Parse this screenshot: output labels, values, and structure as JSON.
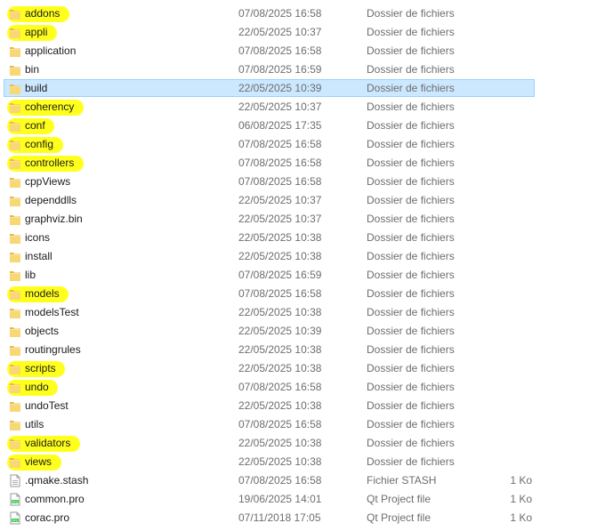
{
  "rows": [
    {
      "name": "addons",
      "date": "07/08/2025 16:58",
      "type": "Dossier de fichiers",
      "size": "",
      "icon": "folder-icon",
      "highlight": true
    },
    {
      "name": "appli",
      "date": "22/05/2025 10:37",
      "type": "Dossier de fichiers",
      "size": "",
      "icon": "folder-icon",
      "highlight": true
    },
    {
      "name": "application",
      "date": "07/08/2025 16:58",
      "type": "Dossier de fichiers",
      "size": "",
      "icon": "folder-icon",
      "highlight": false
    },
    {
      "name": "bin",
      "date": "07/08/2025 16:59",
      "type": "Dossier de fichiers",
      "size": "",
      "icon": "folder-icon",
      "highlight": false
    },
    {
      "name": "build",
      "date": "22/05/2025 10:39",
      "type": "Dossier de fichiers",
      "size": "",
      "icon": "folder-icon",
      "highlight": false,
      "selected": true
    },
    {
      "name": "coherency",
      "date": "22/05/2025 10:37",
      "type": "Dossier de fichiers",
      "size": "",
      "icon": "folder-icon",
      "highlight": true
    },
    {
      "name": "conf",
      "date": "06/08/2025 17:35",
      "type": "Dossier de fichiers",
      "size": "",
      "icon": "folder-icon",
      "highlight": true
    },
    {
      "name": "config",
      "date": "07/08/2025 16:58",
      "type": "Dossier de fichiers",
      "size": "",
      "icon": "folder-icon",
      "highlight": true
    },
    {
      "name": "controllers",
      "date": "07/08/2025 16:58",
      "type": "Dossier de fichiers",
      "size": "",
      "icon": "folder-icon",
      "highlight": true
    },
    {
      "name": "cppViews",
      "date": "07/08/2025 16:58",
      "type": "Dossier de fichiers",
      "size": "",
      "icon": "folder-icon",
      "highlight": false
    },
    {
      "name": "dependdlls",
      "date": "22/05/2025 10:37",
      "type": "Dossier de fichiers",
      "size": "",
      "icon": "folder-icon",
      "highlight": false
    },
    {
      "name": "graphviz.bin",
      "date": "22/05/2025 10:37",
      "type": "Dossier de fichiers",
      "size": "",
      "icon": "folder-icon",
      "highlight": false
    },
    {
      "name": "icons",
      "date": "22/05/2025 10:38",
      "type": "Dossier de fichiers",
      "size": "",
      "icon": "folder-icon",
      "highlight": false
    },
    {
      "name": "install",
      "date": "22/05/2025 10:38",
      "type": "Dossier de fichiers",
      "size": "",
      "icon": "folder-icon",
      "highlight": false
    },
    {
      "name": "lib",
      "date": "07/08/2025 16:59",
      "type": "Dossier de fichiers",
      "size": "",
      "icon": "folder-icon",
      "highlight": false
    },
    {
      "name": "models",
      "date": "07/08/2025 16:58",
      "type": "Dossier de fichiers",
      "size": "",
      "icon": "folder-icon",
      "highlight": true
    },
    {
      "name": "modelsTest",
      "date": "22/05/2025 10:38",
      "type": "Dossier de fichiers",
      "size": "",
      "icon": "folder-icon",
      "highlight": false
    },
    {
      "name": "objects",
      "date": "22/05/2025 10:39",
      "type": "Dossier de fichiers",
      "size": "",
      "icon": "folder-icon",
      "highlight": false
    },
    {
      "name": "routingrules",
      "date": "22/05/2025 10:38",
      "type": "Dossier de fichiers",
      "size": "",
      "icon": "folder-icon",
      "highlight": false
    },
    {
      "name": "scripts",
      "date": "22/05/2025 10:38",
      "type": "Dossier de fichiers",
      "size": "",
      "icon": "folder-icon",
      "highlight": true
    },
    {
      "name": "undo",
      "date": "07/08/2025 16:58",
      "type": "Dossier de fichiers",
      "size": "",
      "icon": "folder-icon",
      "highlight": true
    },
    {
      "name": "undoTest",
      "date": "22/05/2025 10:38",
      "type": "Dossier de fichiers",
      "size": "",
      "icon": "folder-icon",
      "highlight": false
    },
    {
      "name": "utils",
      "date": "07/08/2025 16:58",
      "type": "Dossier de fichiers",
      "size": "",
      "icon": "folder-icon",
      "highlight": false
    },
    {
      "name": "validators",
      "date": "22/05/2025 10:38",
      "type": "Dossier de fichiers",
      "size": "",
      "icon": "folder-icon",
      "highlight": true
    },
    {
      "name": "views",
      "date": "22/05/2025 10:38",
      "type": "Dossier de fichiers",
      "size": "",
      "icon": "folder-icon",
      "highlight": true
    },
    {
      "name": ".qmake.stash",
      "date": "07/08/2025 16:58",
      "type": "Fichier STASH",
      "size": "1 Ko",
      "icon": "generic-file-icon",
      "highlight": false
    },
    {
      "name": "common.pro",
      "date": "19/06/2025 14:01",
      "type": "Qt Project file",
      "size": "1 Ko",
      "icon": "qt-project-file-icon",
      "highlight": false
    },
    {
      "name": "corac.pro",
      "date": "07/11/2018 17:05",
      "type": "Qt Project file",
      "size": "1 Ko",
      "icon": "qt-project-file-icon",
      "highlight": false
    }
  ],
  "colors": {
    "highlight": "#ffff1e",
    "selection": "#cce8ff",
    "folder": "#f8d775",
    "meta_text": "#6d6d6d"
  }
}
